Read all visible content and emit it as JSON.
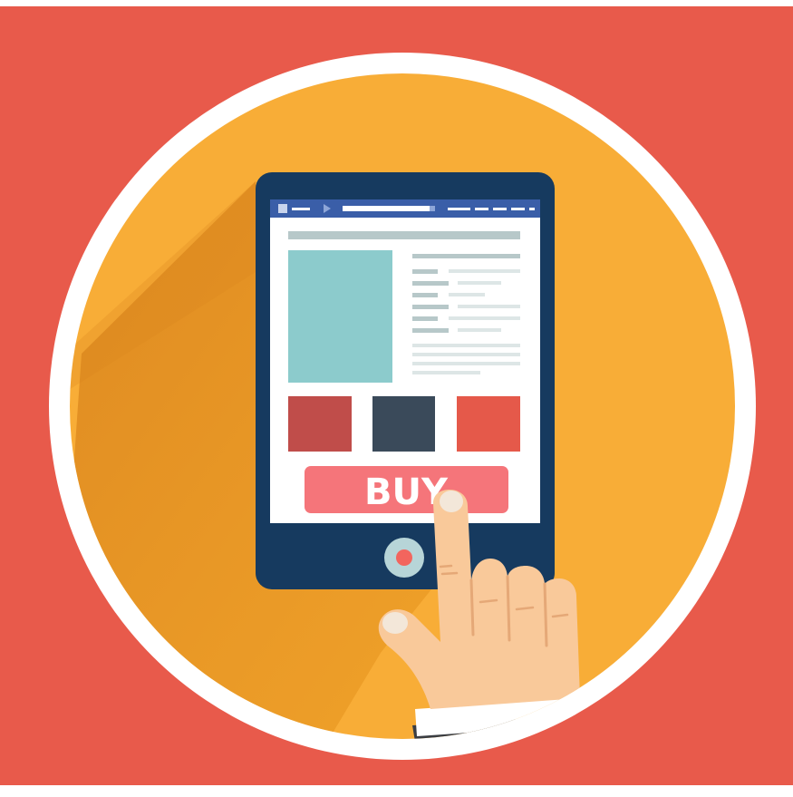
{
  "illustration": {
    "subject": "shopping-on-tablet",
    "buy_button_label": "BUY",
    "icons": {
      "tablet": "tablet-icon",
      "hand": "pointing-hand-icon",
      "home_button": "home-button-icon"
    }
  },
  "colors": {
    "background": "#e85a4b",
    "ring": "#ffffff",
    "circle": "#f8ad37",
    "shadow": "#d77f1a",
    "tablet_body": "#163a5f",
    "browser_bar": "#3a5ea8",
    "screen": "#ffffff",
    "hero_image": "#8ccbcc",
    "swatch_1": "#c04d4a",
    "swatch_2": "#3a4a5a",
    "swatch_3": "#e5594a",
    "buy_button": "#f5757a",
    "skin": "#f9c99a",
    "nail": "#f3e7d9",
    "sleeve": "#ffffff",
    "jacket": "#3a3d42"
  }
}
